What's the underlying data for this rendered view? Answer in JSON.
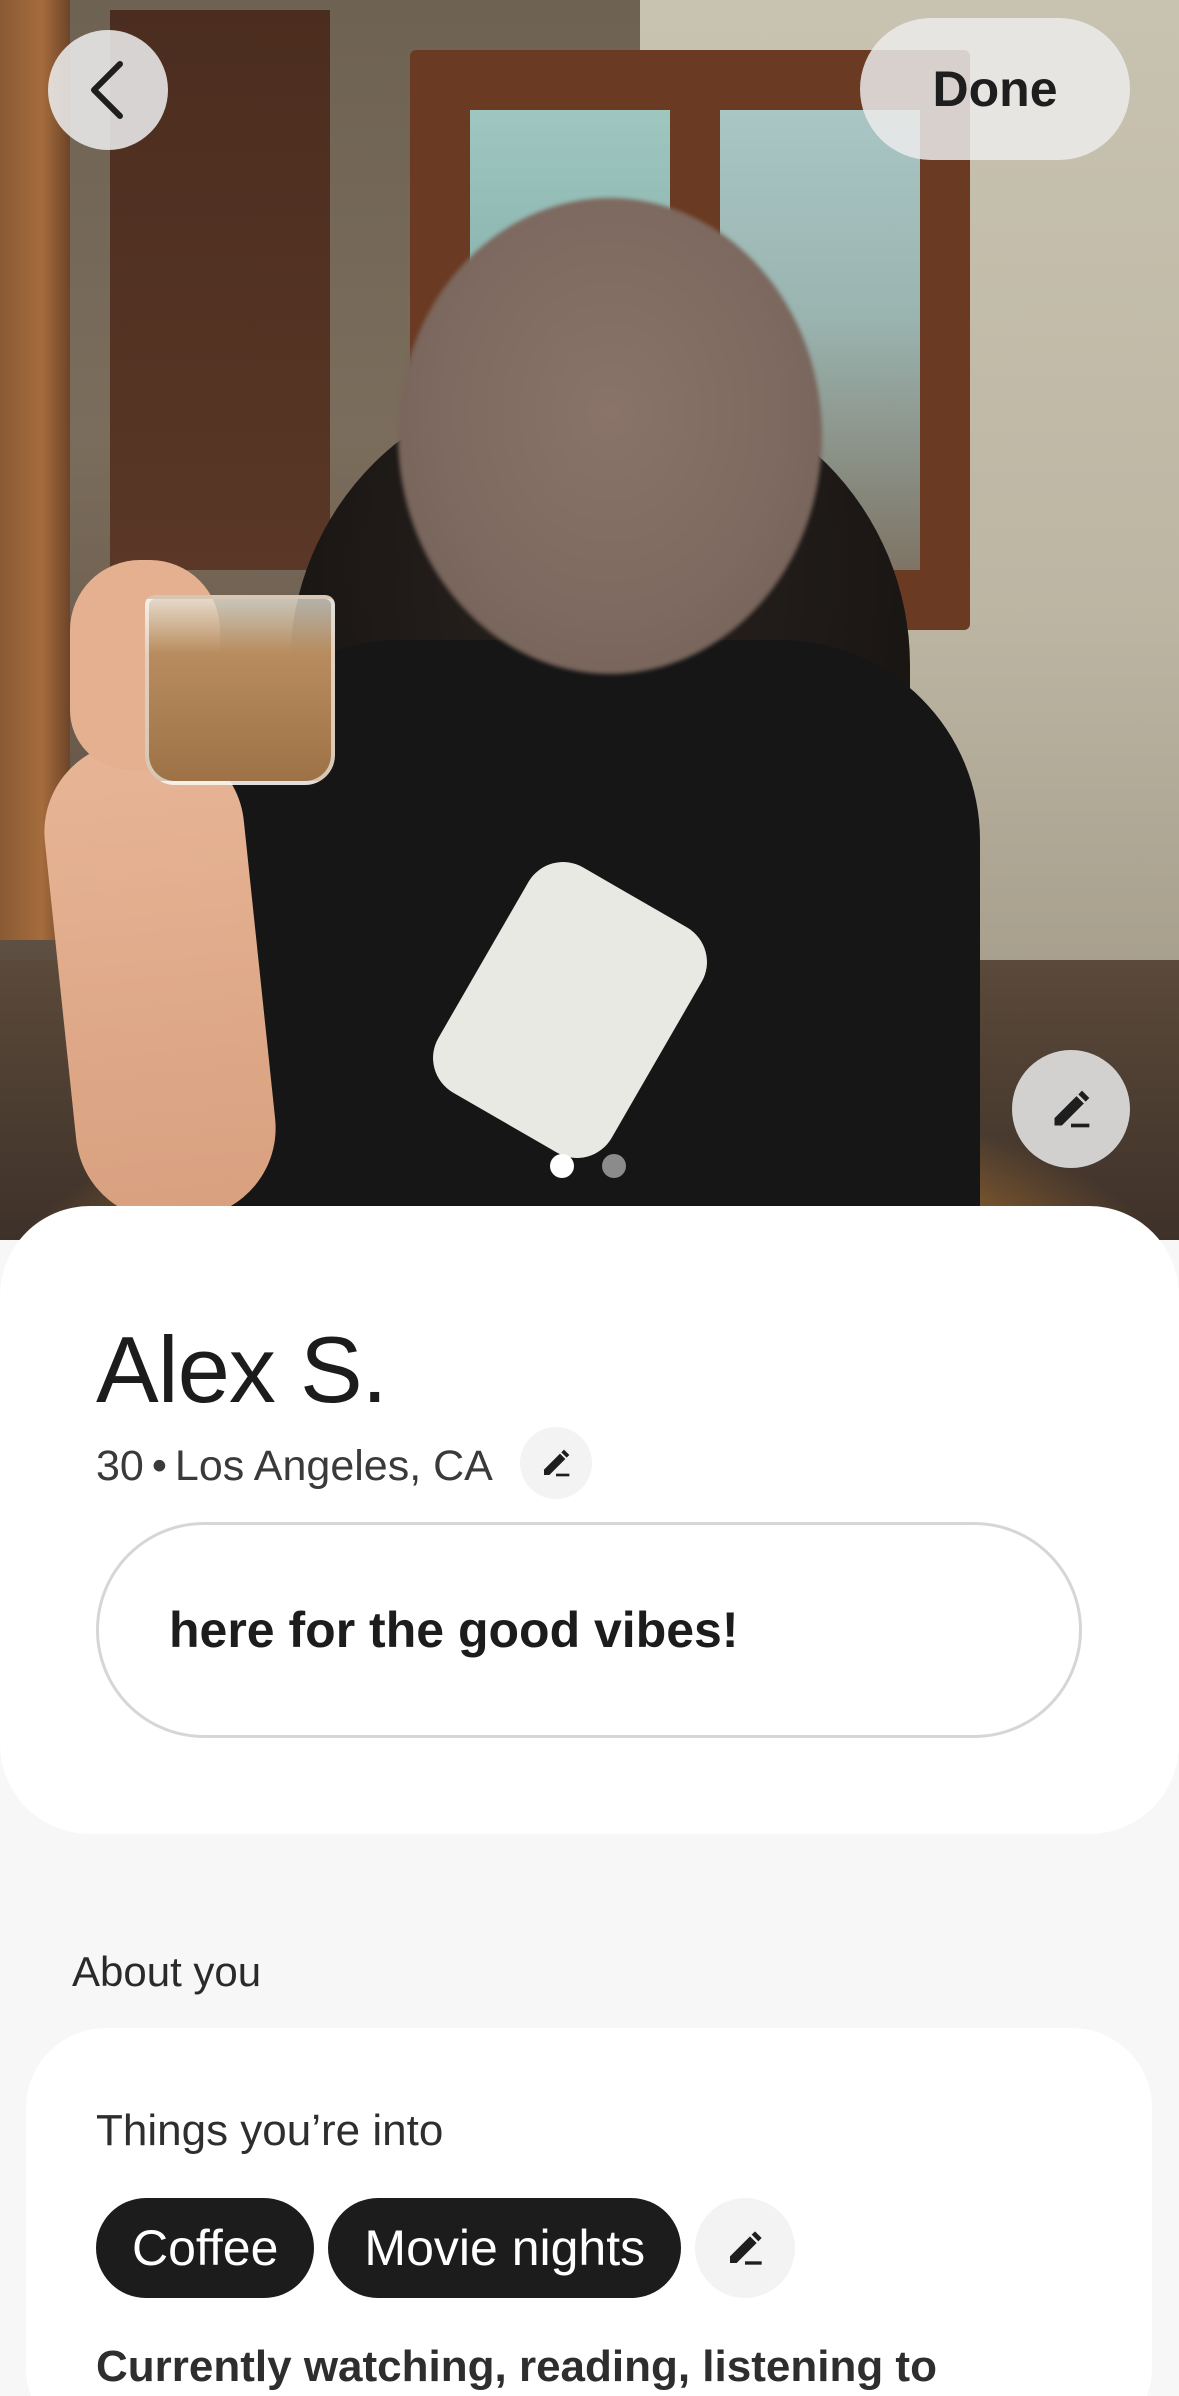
{
  "header": {
    "done_label": "Done"
  },
  "photo": {
    "page_count": 2,
    "current_page": 1
  },
  "profile": {
    "name": "Alex S.",
    "age": "30",
    "separator": "•",
    "location": "Los Angeles, CA",
    "bio": "here for the good vibes!"
  },
  "about": {
    "heading": "About you",
    "interests_label": "Things you’re into",
    "interests": [
      "Coffee",
      "Movie nights"
    ],
    "currently_label": "Currently watching, reading, listening to"
  },
  "icons": {
    "back": "chevron-left-icon",
    "edit": "pencil-icon"
  }
}
